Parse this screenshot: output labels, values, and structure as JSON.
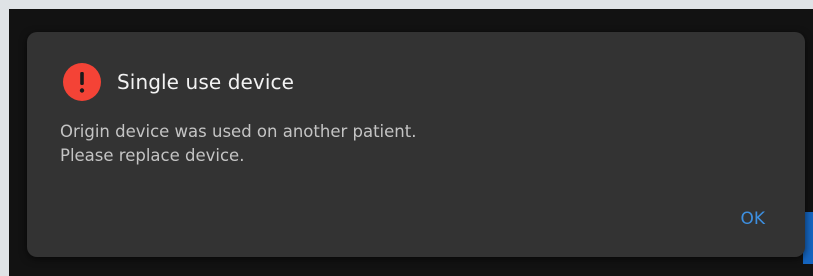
{
  "dialog": {
    "title": "Single use device",
    "message_lines": [
      "Origin device was used on another patient.",
      "Please replace device."
    ],
    "ok_label": "OK",
    "icon": "alert-icon"
  },
  "colors": {
    "dialog_background": "#333333",
    "alert_icon": "#f44336",
    "accent": "#3d8fe0"
  }
}
